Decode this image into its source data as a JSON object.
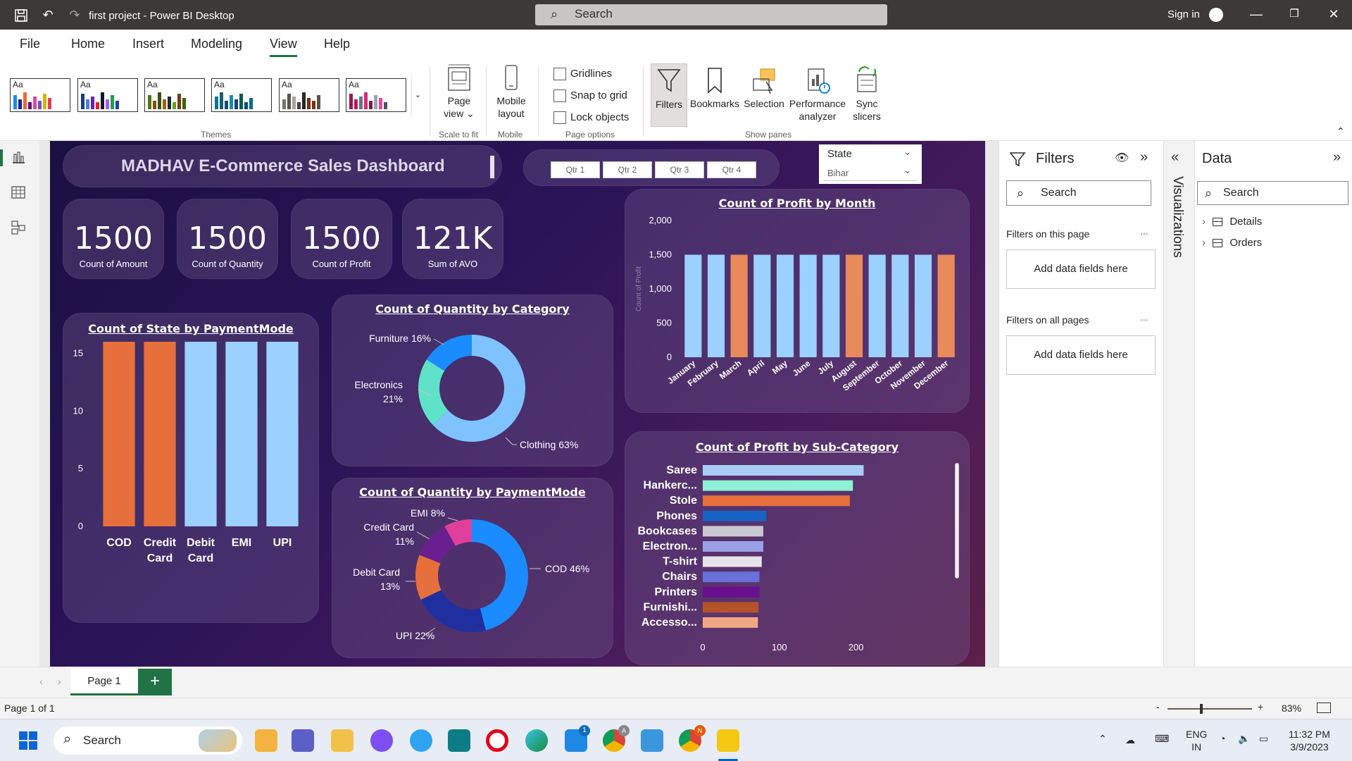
{
  "titlebar": {
    "app_title": "first project - Power BI Desktop",
    "search_placeholder": "Search",
    "sign_in": "Sign in"
  },
  "menu": {
    "items": [
      "File",
      "Home",
      "Insert",
      "Modeling",
      "View",
      "Help"
    ],
    "active": "View"
  },
  "ribbon": {
    "theme_label": "Aa",
    "groups": {
      "themes": "Themes",
      "scale_to_fit": "Scale to fit",
      "mobile": "Mobile",
      "page_options": "Page options",
      "show_panes": "Show panes"
    },
    "page_view": "Page view",
    "mobile_layout": "Mobile layout",
    "checkboxes": [
      "Gridlines",
      "Snap to grid",
      "Lock objects"
    ],
    "panes": [
      "Filters",
      "Bookmarks",
      "Selection",
      "Performance analyzer",
      "Sync slicers"
    ]
  },
  "dashboard": {
    "title": "MADHAV E-Commerce Sales Dashboard",
    "quarters": [
      "Qtr 1",
      "Qtr 2",
      "Qtr 3",
      "Qtr 4"
    ],
    "state_slicer": {
      "label": "State",
      "value": "Bihar"
    },
    "kpis": [
      {
        "value": "1500",
        "label": "Count of Amount"
      },
      {
        "value": "1500",
        "label": "Count of Quantity"
      },
      {
        "value": "1500",
        "label": "Count of Profit"
      },
      {
        "value": "121K",
        "label": "Sum of AVO"
      }
    ]
  },
  "chart_data": [
    {
      "type": "bar",
      "title": "Count of State by PaymentMode",
      "categories": [
        "COD",
        "Credit Card",
        "Debit Card",
        "EMI",
        "UPI"
      ],
      "values": [
        16,
        16,
        16,
        16,
        16
      ],
      "colors": [
        "#e76f3c",
        "#e76f3c",
        "#9bd0ff",
        "#9bd0ff",
        "#9bd0ff"
      ],
      "ylim": [
        0,
        16
      ],
      "yticks": [
        0,
        5,
        10,
        15
      ]
    },
    {
      "type": "pie",
      "title": "Count of Quantity by Category",
      "categories": [
        "Clothing",
        "Electronics",
        "Furniture"
      ],
      "values": [
        63,
        21,
        16
      ],
      "labels": [
        "Clothing 63%",
        "Electronics 21%",
        "Furniture 16%"
      ],
      "colors": [
        "#7ec3ff",
        "#5fe3c8",
        "#1a8cff"
      ]
    },
    {
      "type": "pie",
      "title": "Count of Quantity by PaymentMode",
      "categories": [
        "COD",
        "UPI",
        "Debit Card",
        "Credit Card",
        "EMI"
      ],
      "values": [
        46,
        22,
        13,
        11,
        8
      ],
      "labels": [
        "COD 46%",
        "UPI 22%",
        "Debit Card 13%",
        "Credit Card 11%",
        "EMI 8%"
      ],
      "colors": [
        "#1a8cff",
        "#1f2fa0",
        "#e76f3c",
        "#6a1f8f",
        "#e0409b"
      ]
    },
    {
      "type": "bar",
      "title": "Count of Profit by Month",
      "ylabel": "Count of Profit",
      "categories": [
        "January",
        "February",
        "March",
        "April",
        "May",
        "June",
        "July",
        "August",
        "September",
        "October",
        "November",
        "December"
      ],
      "values": [
        1500,
        1500,
        1500,
        1500,
        1500,
        1500,
        1500,
        1500,
        1500,
        1500,
        1500,
        1500
      ],
      "colors": [
        "#9bd0ff",
        "#9bd0ff",
        "#e98a5a",
        "#9bd0ff",
        "#9bd0ff",
        "#9bd0ff",
        "#9bd0ff",
        "#e98a5a",
        "#9bd0ff",
        "#9bd0ff",
        "#9bd0ff",
        "#e98a5a"
      ],
      "ylim": [
        0,
        2000
      ],
      "yticks": [
        "0",
        "500",
        "1,000",
        "1,500",
        "2,000"
      ]
    },
    {
      "type": "bar",
      "title": "Count of Profit by Sub-Category",
      "orientation": "horizontal",
      "categories": [
        "Saree",
        "Hankerc...",
        "Stole",
        "Phones",
        "Bookcases",
        "Electron...",
        "T-shirt",
        "Chairs",
        "Printers",
        "Furnishi...",
        "Accesso..."
      ],
      "values": [
        210,
        196,
        192,
        83,
        79,
        79,
        77,
        74,
        74,
        73,
        72
      ],
      "colors": [
        "#a9cdf5",
        "#8ef0d5",
        "#e76f3c",
        "#1763c4",
        "#c9c7cf",
        "#9aa0e6",
        "#e7e3ea",
        "#6870d9",
        "#6a0f8f",
        "#b4532a",
        "#f0a884"
      ],
      "xlim": [
        0,
        250
      ],
      "xticks": [
        0,
        100,
        200
      ]
    }
  ],
  "filters": {
    "title": "Filters",
    "search": "Search",
    "this_page": "Filters on this page",
    "all_pages": "Filters on all pages",
    "add_fields": "Add data fields here",
    "more": "..."
  },
  "viz_pane": {
    "label": "Visualizations"
  },
  "data_pane": {
    "title": "Data",
    "search": "Search",
    "tables": [
      "Details",
      "Orders"
    ]
  },
  "pages": {
    "tab": "Page 1",
    "add": "+"
  },
  "status": {
    "page_info": "Page 1 of 1",
    "zoom": "83%",
    "zoom_minus": "-",
    "zoom_plus": "+"
  },
  "taskbar": {
    "search": "Search",
    "lang_line1": "ENG",
    "lang_line2": "IN",
    "time": "11:32 PM",
    "date": "3/9/2023",
    "chrome_badge_a": "A",
    "chrome_badge_n": "N",
    "mail_badge": "1"
  }
}
